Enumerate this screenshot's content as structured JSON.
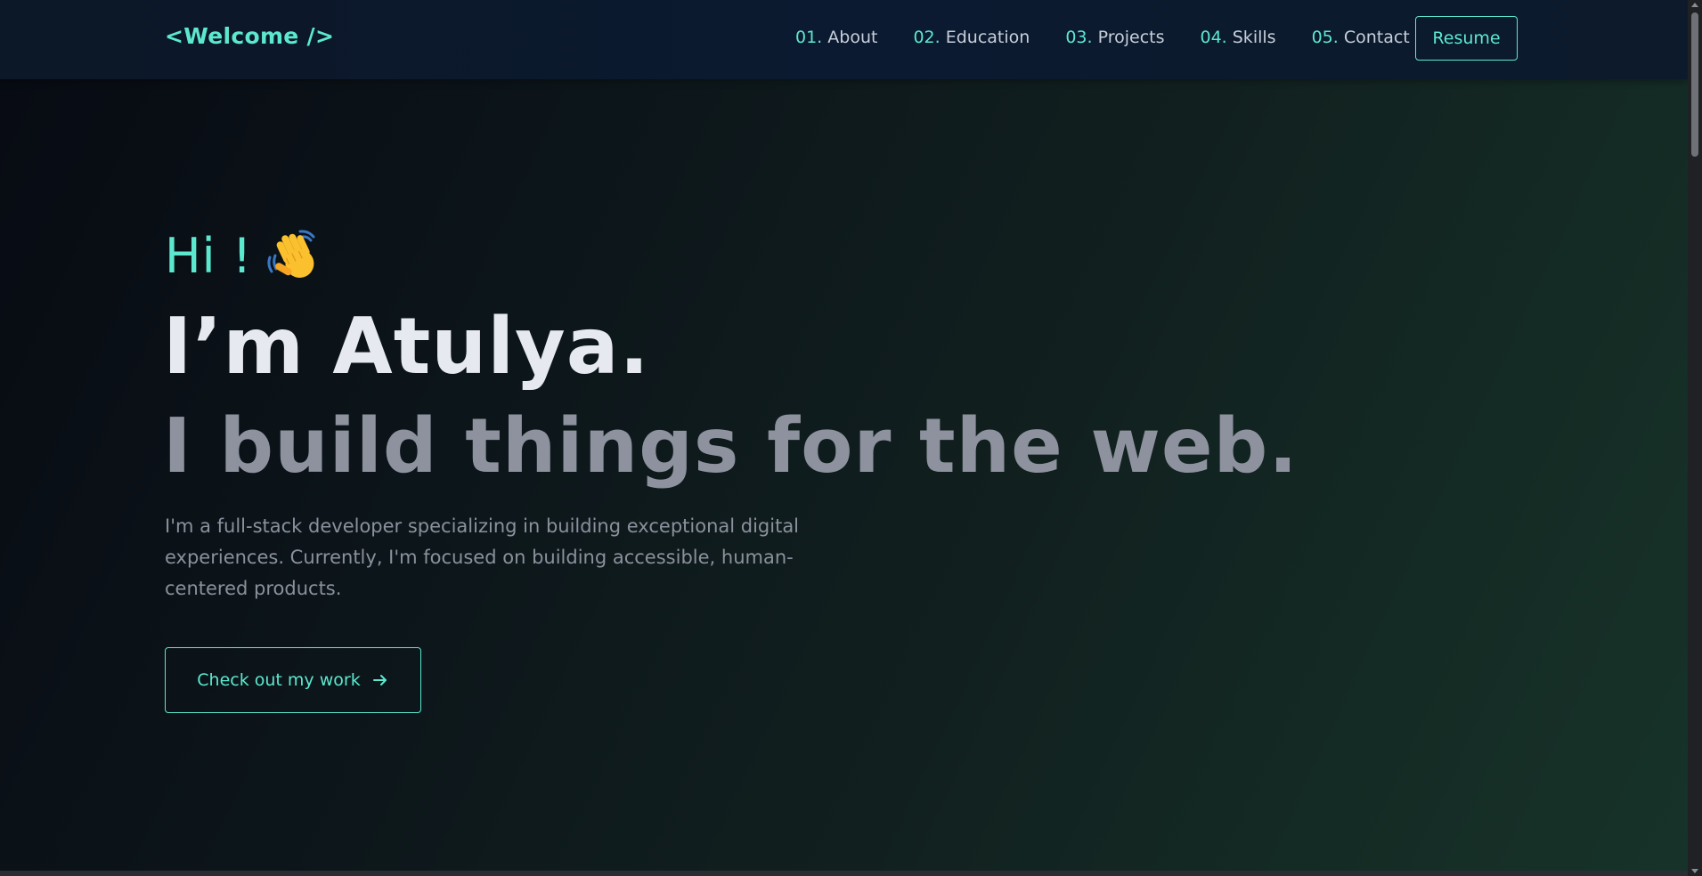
{
  "header": {
    "logo": "<Welcome />",
    "nav": [
      {
        "num": "01.",
        "label": "About"
      },
      {
        "num": "02.",
        "label": "Education"
      },
      {
        "num": "03.",
        "label": "Projects"
      },
      {
        "num": "04.",
        "label": "Skills"
      },
      {
        "num": "05.",
        "label": "Contact"
      }
    ],
    "resume_label": "Resume"
  },
  "hero": {
    "greeting": "Hi !",
    "greeting_icon": "waving-hand-icon",
    "name": "I’m Atulya.",
    "tagline": "I build things for the web.",
    "description": "I'm a full-stack developer specializing in building exceptional digital experiences. Currently, I'm focused on building accessible, human-centered products.",
    "cta_label": "Check out my work",
    "cta_icon": "arrow-right-icon"
  },
  "colors": {
    "accent": "#5ce8cf",
    "heading": "#e6e9ef",
    "muted": "#8d929e",
    "nav_background": "#0c1727"
  }
}
